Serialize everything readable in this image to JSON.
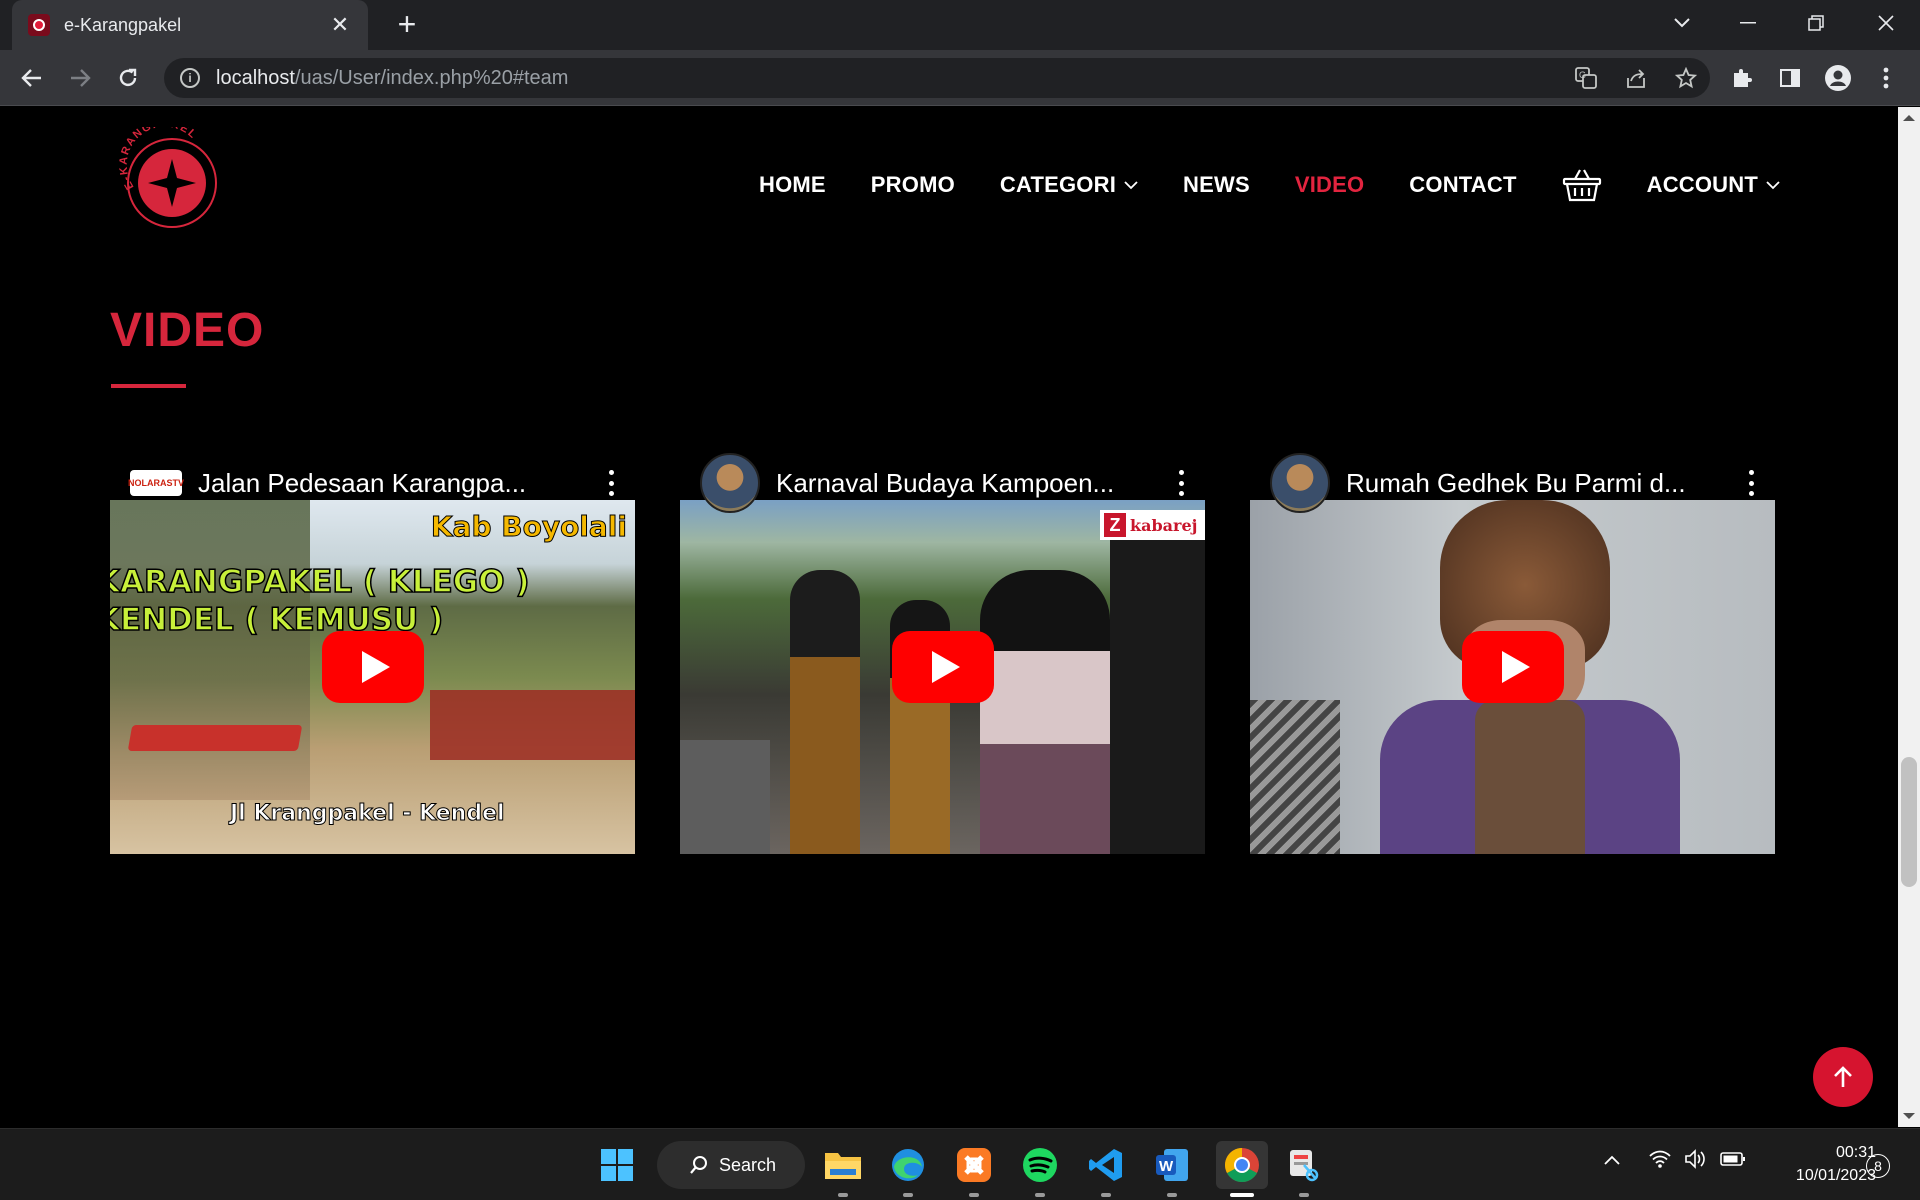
{
  "browser": {
    "tab_title": "e-Karangpakel",
    "url_host": "localhost",
    "url_path": "/uas/User/index.php%20#team"
  },
  "site": {
    "logo_text": "E-KARANGPAKEL",
    "menu": {
      "home": "HOME",
      "promo": "PROMO",
      "categori": "CATEGORI",
      "news": "NEWS",
      "video": "VIDEO",
      "contact": "CONTACT",
      "account": "ACCOUNT"
    },
    "section_title": "VIDEO",
    "accent_color": "#d6263c"
  },
  "videos": [
    {
      "title": "Jalan Pedesaan Karangpa...",
      "channel_badge": "NOLARASTV",
      "overlay_top_right": "Kab Boyolali",
      "overlay_line1": "KARANGPAKEL ( KLEGO )",
      "overlay_line2": "KENDEL ( KEMUSU )",
      "overlay_bottom": "Jl Krangpakel - Kendel"
    },
    {
      "title": "Karnaval Budaya Kampoen...",
      "overlay_logo": "kabarej"
    },
    {
      "title": "Rumah Gedhek Bu Parmi d..."
    }
  ],
  "taskbar": {
    "search_label": "Search",
    "time": "00:31",
    "date": "10/01/2023",
    "notification_count": "8"
  }
}
